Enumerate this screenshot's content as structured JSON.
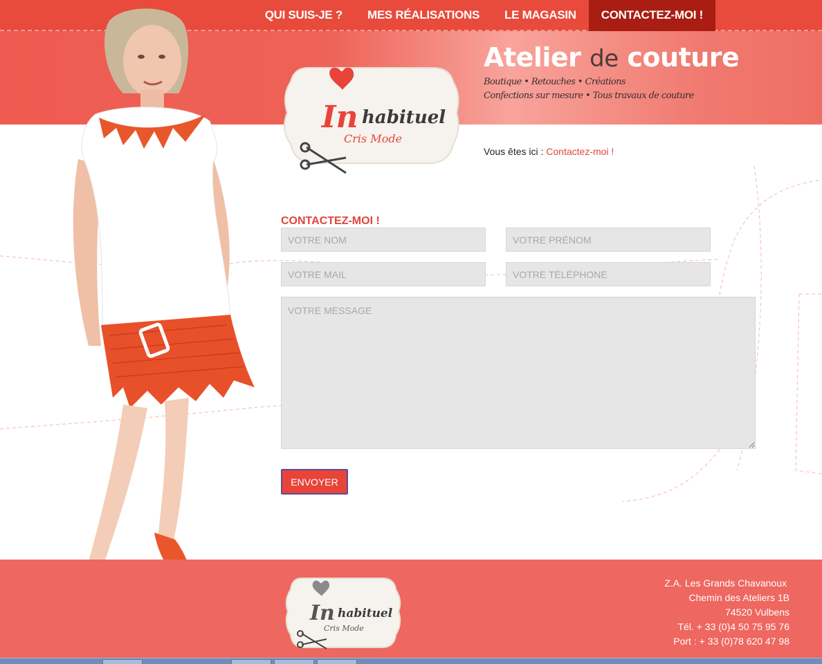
{
  "nav": {
    "items": [
      {
        "label": "QUI SUIS-JE ?",
        "active": false
      },
      {
        "label": "MES RÉALISATIONS",
        "active": false
      },
      {
        "label": "LE MAGASIN",
        "active": false
      },
      {
        "label": "CONTACTEZ-MOI !",
        "active": true
      }
    ]
  },
  "header": {
    "title_part1": "Atelier",
    "title_part2": "de",
    "title_part3": "couture",
    "tagline1": "Boutique • Retouches • Créations",
    "tagline2": "Confections sur mesure • Tous travaux de couture"
  },
  "logo": {
    "brand_in": "In",
    "brand_rest": "habituel",
    "sub": "Cris Mode"
  },
  "breadcrumb": {
    "prefix": "Vous êtes ici :",
    "current": "Contactez-moi !"
  },
  "form": {
    "title": "CONTACTEZ-MOI !",
    "name_placeholder": "VOTRE NOM",
    "firstname_placeholder": "VOTRE PRÉNOM",
    "mail_placeholder": "VOTRE MAIL",
    "phone_placeholder": "VOTRE TÉLÉPHONE",
    "message_placeholder": "VOTRE MESSAGE",
    "submit_label": "ENVOYER"
  },
  "footer": {
    "line1": "Z.A. Les Grands Chavanoux",
    "line2": "Chemin des Ateliers 1B",
    "line3": "74520 Vulbens",
    "line4": "Tél. + 33 (0)4 50 75 95 76",
    "line5": "Port : + 33 (0)78 620 47 98"
  },
  "colors": {
    "brand_red": "#e84a3b",
    "active_nav": "#a91d13",
    "footer_bg": "#ee6760"
  }
}
